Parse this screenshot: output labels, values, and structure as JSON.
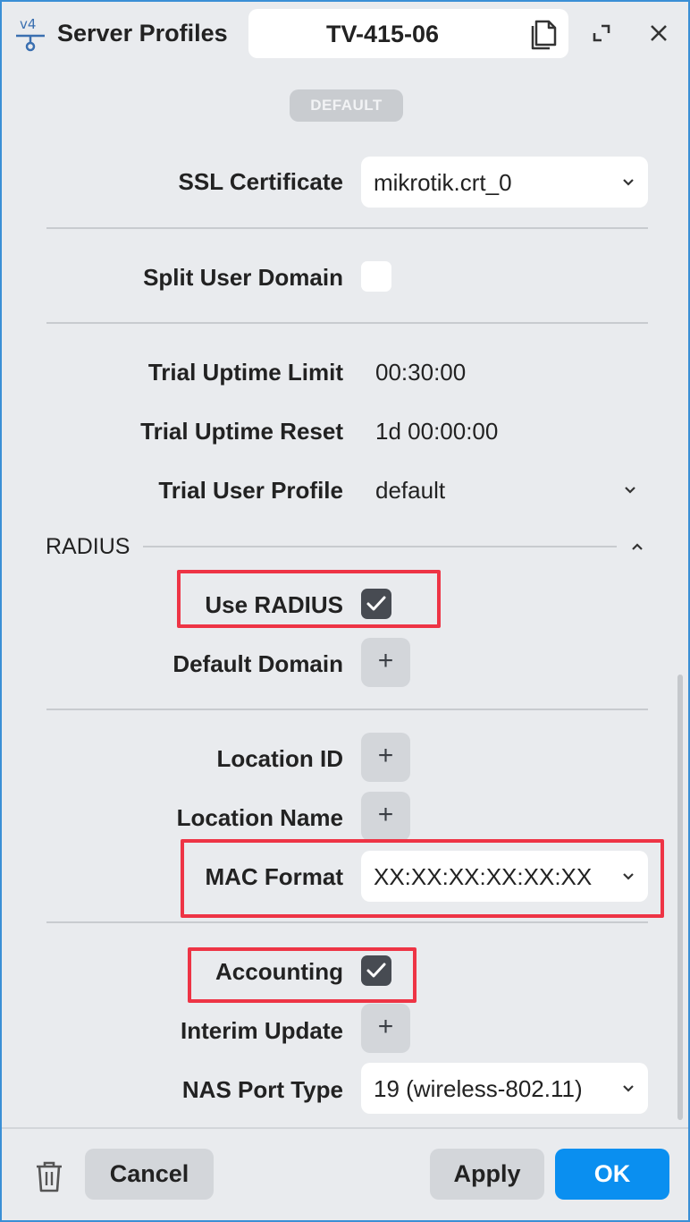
{
  "window": {
    "title": "Server Profiles",
    "name": "TV-415-06",
    "accent_color": "#3a8fd6"
  },
  "badge": "DEFAULT",
  "fields": {
    "ssl_certificate": {
      "label": "SSL Certificate",
      "value": "mikrotik.crt_0"
    },
    "split_user_domain": {
      "label": "Split User Domain",
      "checked": false
    },
    "trial_uptime_limit": {
      "label": "Trial Uptime Limit",
      "value": "00:30:00"
    },
    "trial_uptime_reset": {
      "label": "Trial Uptime Reset",
      "value": "1d 00:00:00"
    },
    "trial_user_profile": {
      "label": "Trial User Profile",
      "value": "default"
    }
  },
  "radius": {
    "section_title": "RADIUS",
    "use_radius": {
      "label": "Use RADIUS",
      "checked": true
    },
    "default_domain": {
      "label": "Default Domain",
      "button": "+"
    },
    "location_id": {
      "label": "Location ID",
      "button": "+"
    },
    "location_name": {
      "label": "Location Name",
      "button": "+"
    },
    "mac_format": {
      "label": "MAC Format",
      "value": "XX:XX:XX:XX:XX:XX"
    },
    "accounting": {
      "label": "Accounting",
      "checked": true
    },
    "interim_update": {
      "label": "Interim Update",
      "button": "+"
    },
    "nas_port_type": {
      "label": "NAS Port Type",
      "value": "19 (wireless-802.11)"
    }
  },
  "footer": {
    "cancel_label": "Cancel",
    "apply_label": "Apply",
    "ok_label": "OK",
    "ok_color": "#0a8ff0"
  },
  "highlight_color": "#ee3445",
  "icons": [
    "app-v4-icon",
    "copy-icon",
    "maximize-icon",
    "close-icon",
    "chevron-down-icon",
    "chevron-up-icon",
    "checkmark-icon",
    "plus-icon",
    "trash-icon"
  ]
}
